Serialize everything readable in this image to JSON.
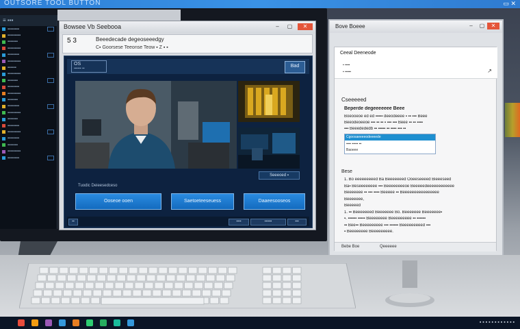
{
  "top_strip": {
    "text": "OUTSORE TOOL BUTTON",
    "controls": "▭ ✕"
  },
  "left_sidebar": {
    "header": "≡ ▪▪▪",
    "items": [
      "▪▪▪▪▪▪▪▪",
      "▪▪▪▪▪▪▪▪▪",
      "▪▪▪▪▪▪▪",
      "▪▪▪▪▪▪▪▪▪",
      "▪▪▪▪▪▪▪▪",
      "▪▪▪▪▪▪▪▪▪",
      "▪▪▪▪▪▪",
      "▪▪▪▪▪▪▪▪▪",
      "▪▪▪▪▪▪▪",
      "▪▪▪▪▪▪▪▪",
      "▪▪▪▪▪▪▪▪▪",
      "▪▪▪▪▪▪▪",
      "▪▪▪▪▪▪▪▪",
      "▪▪▪▪▪▪▪▪▪",
      "▪▪▪▪▪▪▪",
      "▪▪▪▪▪▪▪▪",
      "▪▪▪▪▪▪▪▪▪",
      "▪▪▪▪▪▪▪▪",
      "▪▪▪▪▪▪▪",
      "▪▪▪▪▪▪▪▪▪",
      "▪▪▪▪▪▪▪▪"
    ],
    "icon_colors": [
      "#2a9bd8",
      "#e1b02a",
      "#3fb950",
      "#d94a3a",
      "#2a9bd8",
      "#9b59b6",
      "#e1b02a",
      "#2a9bd8",
      "#3fb950",
      "#d94a3a",
      "#e67e22",
      "#2a9bd8",
      "#e1b02a",
      "#3fb950",
      "#2a9bd8",
      "#d94a3a",
      "#e1b02a",
      "#2a9bd8",
      "#3fb950",
      "#9b59b6",
      "#2a9bd8"
    ]
  },
  "main_window": {
    "title": "Bowsee    Vb Seebooa",
    "address_left": "5 3",
    "address_title": "Beeedecade degeoseeedgy",
    "address_sub": "C▪ Goorsese Teeonse Teow ▪ Z ▪ ▪",
    "header_logo": "OS",
    "header_logo_sub": "▪▪▪▪▪▪ ▪▪",
    "header_button": "Bad",
    "thumbnail_label": "Seeeoed ▪",
    "sub_label": "Tuodic Deieesedceso",
    "buttons": [
      "Ooseoe ooen",
      "Saetoeteeseuess",
      "Daaeesooseos"
    ],
    "footer_buttons": [
      "▪▪",
      "▪▪▪▪",
      "▪▪▪▪▪▪",
      "▪▪▪"
    ]
  },
  "right_window": {
    "title": "Bove Boeee",
    "nav_title": "Ceeal Deeneode",
    "nav_sub1": "▪ ▪▪▪▪",
    "nav_sub2": "▪ ▪▪▪▪▪",
    "section_heading": "Cseeeeed",
    "section_title": "Beperde degeeeeeee Beee",
    "para1": [
      "Boeooeoe ed ed ▪▪▪▪▪ deeodeeee ▪ ▪▪ ▪▪▪ Beee",
      "Beeodeoeeoe ▪▪▪ ▪▪ ▪▪ ▪ ▪▪▪ ▪▪▪ Beee ▪▪ ▪▪ ▪▪▪▪",
      "▪▪▪ Beeedededb ▪▪ ▪▪▪▪▪ ▪▪ ▪▪▪▪ ▪▪▪ ▪▪"
    ],
    "select_options": [
      "Cgoosaeeeeodeeeede",
      "▪▪▪▪ ▪▪▪▪▪ ▪▪",
      "Baoeee"
    ],
    "steps_heading": "Bese",
    "steps": [
      "1.  Bo eeeeeeeeed Ba Beeeeeeed Ooeeseeeed Bieeeseed",
      "Ba▪ Beseeeeeeee ▪▪▪ Beeeeeeeeoe Beeeeedeeeeeeeeeeee",
      "Beeeeeee ▪▪ ▪▪▪ ▪▪▪▪ Beeeee ▪▪ Beeeeeeeeeeeeeeee",
      "Beeeeeee,",
      "Beeeeed",
      "1. ▪▪ Beeeeeeed Beeeeeee Bo. Beeeeeee Beeeeeee▪",
      "▪. ▪▪▪▪▪▪ ▪▪▪▪▪ Beeeeeeee Beeeeeeeee ▪▪ ▪▪▪▪▪▪",
      "▪▪ Bee▪▪ Beeeeeeeee ▪▪▪ ▪▪▪▪▪▪ Beeeeeeeeed ▪▪▪",
      "▪ Beeeeeeee Beeeeeeeee."
    ],
    "footer_left": "Bebe Boe",
    "footer_right": "Qeeeeee"
  },
  "taskbar": {
    "icon_colors": [
      "#e74c3c",
      "#f39c12",
      "#9b59b6",
      "#3498db",
      "#e67e22",
      "#2ecc71",
      "#27ae60",
      "#1abc9c",
      "#3498db"
    ],
    "tray_text": "▪ ▪ ▪ ▪ ▪ ▪ ▪ ▪ ▪ ▪ ▪ ▪"
  }
}
